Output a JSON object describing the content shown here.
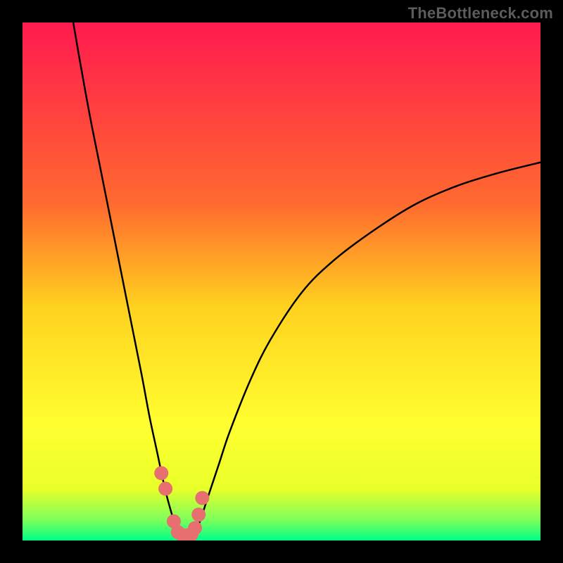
{
  "watermark": "TheBottleneck.com",
  "colors": {
    "frame": "#000000",
    "curve": "#000000",
    "marker": "#e76f6f",
    "gradient_stops": [
      {
        "offset": 0.0,
        "color": "#ff1a4f"
      },
      {
        "offset": 0.35,
        "color": "#ff6a2f"
      },
      {
        "offset": 0.55,
        "color": "#ffd21f"
      },
      {
        "offset": 0.78,
        "color": "#ffff30"
      },
      {
        "offset": 0.9,
        "color": "#e9ff2a"
      },
      {
        "offset": 0.96,
        "color": "#7dff5a"
      },
      {
        "offset": 1.0,
        "color": "#00ff89"
      }
    ]
  },
  "chart_data": {
    "type": "line",
    "title": "",
    "xlabel": "",
    "ylabel": "",
    "xlim": [
      0,
      100
    ],
    "ylim": [
      0,
      100
    ],
    "series": [
      {
        "name": "bottleneck-curve",
        "x": [
          9.8,
          11,
          13,
          15,
          17,
          19,
          21,
          23,
          24.5,
          26,
          27.5,
          28.7,
          29.6,
          30.2,
          31,
          32,
          33,
          34,
          36,
          38,
          40,
          44,
          48,
          54,
          60,
          68,
          76,
          84,
          92,
          100
        ],
        "y": [
          100,
          93,
          82,
          72,
          62,
          52,
          42,
          32,
          24,
          17,
          10,
          5.5,
          2.6,
          1.3,
          0.9,
          0.9,
          1.1,
          3.0,
          9,
          15,
          21,
          31,
          39,
          48,
          54,
          60,
          65,
          68.5,
          71,
          73
        ]
      }
    ],
    "markers": {
      "name": "highlight-points",
      "x": [
        26.8,
        27.6,
        29.2,
        30.0,
        30.9,
        31.8,
        32.6,
        33.3,
        34.0,
        34.7
      ],
      "y": [
        13.0,
        10.0,
        3.7,
        1.6,
        1.0,
        1.0,
        1.2,
        2.4,
        5.0,
        8.2
      ]
    }
  }
}
